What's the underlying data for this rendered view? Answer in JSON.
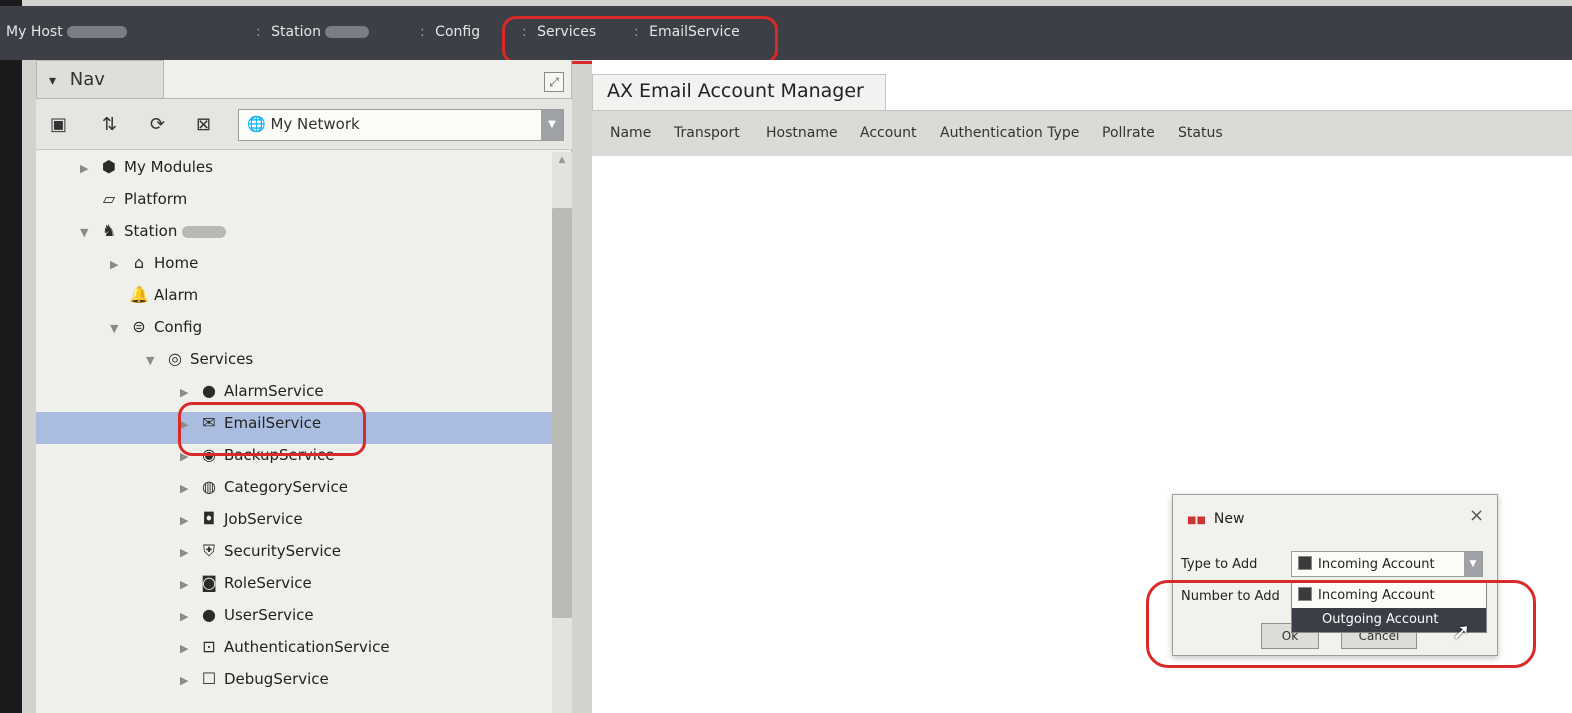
{
  "breadcrumb": {
    "host": "My Host",
    "station": "Station",
    "config": "Config",
    "services": "Services",
    "email_service": "EmailService",
    "separator": ":"
  },
  "nav": {
    "tab_label": "Nav",
    "tab_arrow": "▾",
    "network_select": {
      "value": "My Network"
    },
    "tree": [
      {
        "id": "my-modules",
        "label": "My Modules",
        "icon": "modules-icon",
        "expanded": false
      },
      {
        "id": "platform",
        "label": "Platform",
        "icon": "platform-icon",
        "expanded": null
      },
      {
        "id": "station",
        "label": "Station",
        "icon": "station-icon",
        "expanded": true
      },
      {
        "id": "home",
        "label": "Home",
        "icon": "home-icon",
        "expanded": false
      },
      {
        "id": "alarm",
        "label": "Alarm",
        "icon": "bell-icon",
        "expanded": null
      },
      {
        "id": "config",
        "label": "Config",
        "icon": "database-icon",
        "expanded": true
      },
      {
        "id": "services",
        "label": "Services",
        "icon": "services-icon",
        "expanded": true
      },
      {
        "id": "alarm-service",
        "label": "AlarmService",
        "icon": "alarm-service-icon",
        "expanded": false
      },
      {
        "id": "email-service",
        "label": "EmailService",
        "icon": "envelope-icon",
        "expanded": false,
        "selected": true
      },
      {
        "id": "backup-service",
        "label": "BackupService",
        "icon": "backup-icon",
        "expanded": false
      },
      {
        "id": "category-service",
        "label": "CategoryService",
        "icon": "category-icon",
        "expanded": false
      },
      {
        "id": "job-service",
        "label": "JobService",
        "icon": "job-icon",
        "expanded": false
      },
      {
        "id": "security-service",
        "label": "SecurityService",
        "icon": "shield-icon",
        "expanded": false
      },
      {
        "id": "role-service",
        "label": "RoleService",
        "icon": "role-icon",
        "expanded": false
      },
      {
        "id": "user-service",
        "label": "UserService",
        "icon": "user-icon",
        "expanded": false
      },
      {
        "id": "authentication-service",
        "label": "AuthenticationService",
        "icon": "lock-icon",
        "expanded": false
      },
      {
        "id": "debug-service",
        "label": "DebugService",
        "icon": "debug-icon",
        "expanded": false
      }
    ]
  },
  "main": {
    "tab_title": "AX Email Account Manager",
    "columns": [
      "Name",
      "Transport",
      "Hostname",
      "Account",
      "Authentication Type",
      "Pollrate",
      "Status"
    ]
  },
  "dialog": {
    "title": "New",
    "close": "×",
    "type_label": "Type to Add",
    "number_label": "Number to Add",
    "type_value": "Incoming Account",
    "options": [
      "Incoming Account",
      "Outgoing Account"
    ],
    "highlighted_option": "Outgoing Account",
    "ok_label": "Ok",
    "cancel_label": "Cancel"
  },
  "colors": {
    "annotation_red": "#d92a2a",
    "selection_blue": "#aabde0",
    "crumb_bar": "#3c3f45"
  }
}
